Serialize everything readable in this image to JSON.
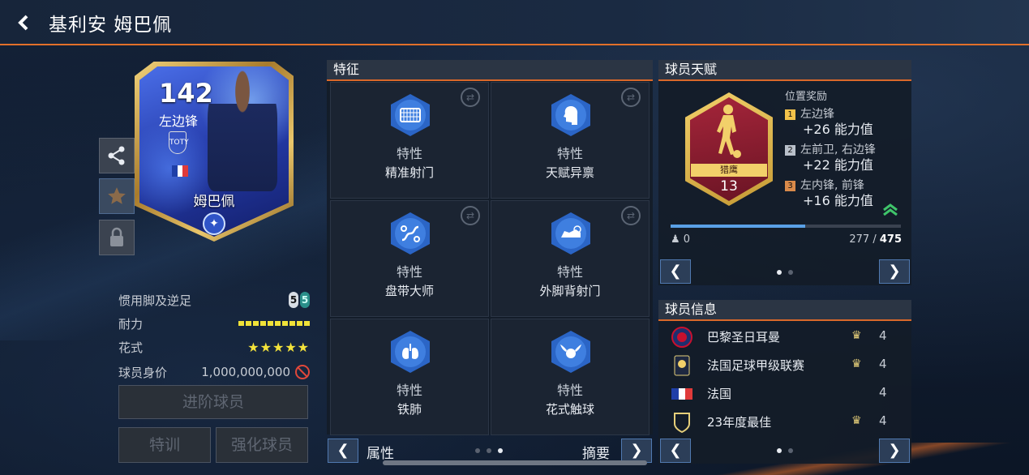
{
  "header": {
    "title": "基利安 姆巴佩",
    "back_icon": "chevron-left-icon"
  },
  "card": {
    "rating": "142",
    "position": "左边锋",
    "badge": "TOTY",
    "name": "姆巴佩",
    "flag_colors": [
      "#1f3fa8",
      "#ffffff",
      "#e03a3a"
    ]
  },
  "stats": {
    "preferred_foot_label": "惯用脚及逆足",
    "preferred_foot": {
      "left": "5",
      "right": "5"
    },
    "stamina_label": "耐力",
    "stamina_level": 1.0,
    "skill_label": "花式",
    "skill_stars": "★★★★★",
    "value_label": "球员身价",
    "value": "1,000,000,000"
  },
  "buttons": {
    "upgrade": "进阶球员",
    "training": "特训",
    "enhance": "强化球员"
  },
  "traits_panel": {
    "title": "特征",
    "items": [
      {
        "type": "特性",
        "name": "精准射门"
      },
      {
        "type": "特性",
        "name": "天赋异禀"
      },
      {
        "type": "特性",
        "name": "盘带大师"
      },
      {
        "type": "特性",
        "name": "外脚背射门"
      },
      {
        "type": "特性",
        "name": "铁肺"
      },
      {
        "type": "特性",
        "name": "花式触球"
      }
    ],
    "prev_label": "属性",
    "next_label": "摘要"
  },
  "talent_panel": {
    "title": "球员天赋",
    "talent_name": "猎鹰",
    "talent_level": "13",
    "bonus_title": "位置奖励",
    "bonuses": [
      {
        "rank": "1",
        "positions": "左边锋",
        "value": "+26 能力值"
      },
      {
        "rank": "2",
        "positions": "左前卫, 右边锋",
        "value": "+22 能力值"
      },
      {
        "rank": "3",
        "positions": "左内锋, 前锋",
        "value": "+16 能力值"
      }
    ],
    "progress_left": "0",
    "progress_current": "277",
    "progress_sep": " / ",
    "progress_total": "475",
    "progress_fraction": 0.583
  },
  "info_panel": {
    "title": "球员信息",
    "rows": [
      {
        "label": "巴黎圣日耳曼",
        "level": "4"
      },
      {
        "label": "法国足球甲级联赛",
        "level": "4"
      },
      {
        "label": "法国",
        "level": "4"
      },
      {
        "label": "23年度最佳",
        "level": "4"
      }
    ]
  },
  "nav": {
    "prev": "❮",
    "next": "❯"
  },
  "colors": {
    "accent_orange": "#d9682a",
    "trait_blue": "#2b65c6",
    "talent_red": "#a5253a",
    "gold": "#f2d06a"
  }
}
